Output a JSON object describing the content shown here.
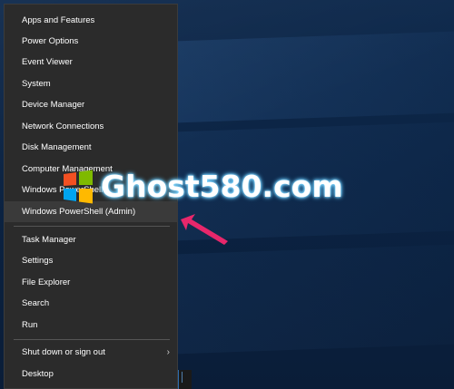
{
  "menu": {
    "items": [
      {
        "label": "Apps and Features"
      },
      {
        "label": "Power Options"
      },
      {
        "label": "Event Viewer"
      },
      {
        "label": "System"
      },
      {
        "label": "Device Manager"
      },
      {
        "label": "Network Connections"
      },
      {
        "label": "Disk Management"
      },
      {
        "label": "Computer Management"
      },
      {
        "label": "Windows PowerShell"
      },
      {
        "label": "Windows PowerShell (Admin)"
      },
      {
        "label": "Task Manager"
      },
      {
        "label": "Settings"
      },
      {
        "label": "File Explorer"
      },
      {
        "label": "Search"
      },
      {
        "label": "Run"
      },
      {
        "label": "Shut down or sign out",
        "submenu_icon": "chevron-right-icon"
      },
      {
        "label": "Desktop"
      }
    ]
  },
  "watermark": {
    "text": "Ghost580.com",
    "logo_icon": "windows-logo-icon"
  },
  "annotation": {
    "arrow_icon": "pink-arrow-icon",
    "arrow_color": "#e8276b"
  },
  "colors": {
    "menu_background": "#2b2b2b",
    "highlight": "#3a3a3a",
    "desktop": "#0b2343"
  }
}
